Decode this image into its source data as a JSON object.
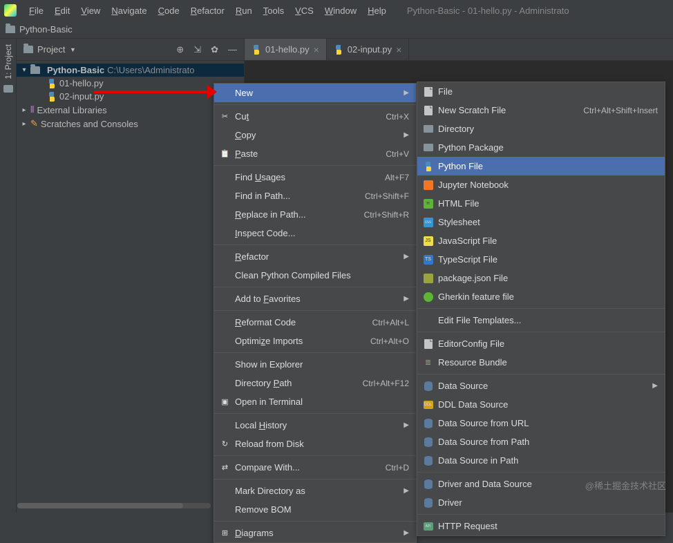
{
  "window_title": "Python-Basic - 01-hello.py - Administrato",
  "menus": [
    "File",
    "Edit",
    "View",
    "Navigate",
    "Code",
    "Refactor",
    "Run",
    "Tools",
    "VCS",
    "Window",
    "Help"
  ],
  "breadcrumb_root": "Python-Basic",
  "sidebar_tab": "1: Project",
  "project_selector": "Project",
  "header_icons": [
    "target",
    "autoscroll",
    "settings",
    "minimize"
  ],
  "tree": {
    "root": {
      "name": "Python-Basic",
      "path": "C:\\Users\\Administrato"
    },
    "files": [
      "01-hello.py",
      "02-input.py"
    ],
    "items": [
      "External Libraries",
      "Scratches and Consoles"
    ]
  },
  "tabs": [
    {
      "name": "01-hello.py",
      "active": true
    },
    {
      "name": "02-input.py",
      "active": false
    }
  ],
  "context_menu_1": [
    {
      "t": "hl",
      "label": "New",
      "submenu": true
    },
    {
      "t": "sep"
    },
    {
      "t": "item",
      "label": "Cut",
      "sc": "Ctrl+X",
      "ul": "t",
      "ico": "scissors"
    },
    {
      "t": "item",
      "label": "Copy",
      "sc": "",
      "ul": "C",
      "submenu": true
    },
    {
      "t": "item",
      "label": "Paste",
      "sc": "Ctrl+V",
      "ul": "P",
      "ico": "paste"
    },
    {
      "t": "sep"
    },
    {
      "t": "item",
      "label": "Find Usages",
      "sc": "Alt+F7",
      "ul": "U"
    },
    {
      "t": "item",
      "label": "Find in Path...",
      "sc": "Ctrl+Shift+F"
    },
    {
      "t": "item",
      "label": "Replace in Path...",
      "sc": "Ctrl+Shift+R",
      "ul": "R"
    },
    {
      "t": "item",
      "label": "Inspect Code...",
      "ul": "I"
    },
    {
      "t": "sep"
    },
    {
      "t": "item",
      "label": "Refactor",
      "ul": "R",
      "submenu": true
    },
    {
      "t": "item",
      "label": "Clean Python Compiled Files"
    },
    {
      "t": "sep"
    },
    {
      "t": "item",
      "label": "Add to Favorites",
      "ul": "F",
      "submenu": true
    },
    {
      "t": "sep"
    },
    {
      "t": "item",
      "label": "Reformat Code",
      "sc": "Ctrl+Alt+L",
      "ul": "R"
    },
    {
      "t": "item",
      "label": "Optimize Imports",
      "sc": "Ctrl+Alt+O",
      "ul": "z"
    },
    {
      "t": "sep"
    },
    {
      "t": "item",
      "label": "Show in Explorer"
    },
    {
      "t": "item",
      "label": "Directory Path",
      "sc": "Ctrl+Alt+F12",
      "ul": "P"
    },
    {
      "t": "item",
      "label": "Open in Terminal",
      "ico": "terminal"
    },
    {
      "t": "sep"
    },
    {
      "t": "item",
      "label": "Local History",
      "ul": "H",
      "submenu": true
    },
    {
      "t": "item",
      "label": "Reload from Disk",
      "ico": "reload"
    },
    {
      "t": "sep"
    },
    {
      "t": "item",
      "label": "Compare With...",
      "sc": "Ctrl+D",
      "ico": "compare"
    },
    {
      "t": "sep"
    },
    {
      "t": "item",
      "label": "Mark Directory as",
      "submenu": true
    },
    {
      "t": "item",
      "label": "Remove BOM"
    },
    {
      "t": "sep"
    },
    {
      "t": "item",
      "label": "Diagrams",
      "ul": "D",
      "submenu": true,
      "ico": "diagram"
    }
  ],
  "context_menu_2": [
    {
      "t": "item",
      "label": "File",
      "ico": "file"
    },
    {
      "t": "item",
      "label": "New Scratch File",
      "sc": "Ctrl+Alt+Shift+Insert",
      "ico": "file"
    },
    {
      "t": "item",
      "label": "Directory",
      "ico": "dir"
    },
    {
      "t": "item",
      "label": "Python Package",
      "ico": "dir"
    },
    {
      "t": "hl",
      "label": "Python File",
      "ico": "py"
    },
    {
      "t": "item",
      "label": "Jupyter Notebook",
      "ico": "ipynb"
    },
    {
      "t": "item",
      "label": "HTML File",
      "ico": "html"
    },
    {
      "t": "item",
      "label": "Stylesheet",
      "ico": "css"
    },
    {
      "t": "item",
      "label": "JavaScript File",
      "ico": "js"
    },
    {
      "t": "item",
      "label": "TypeScript File",
      "ico": "ts"
    },
    {
      "t": "item",
      "label": "package.json File",
      "ico": "json"
    },
    {
      "t": "item",
      "label": "Gherkin feature file",
      "ico": "gherkin"
    },
    {
      "t": "sep"
    },
    {
      "t": "item",
      "label": "Edit File Templates..."
    },
    {
      "t": "sep"
    },
    {
      "t": "item",
      "label": "EditorConfig File",
      "ico": "file"
    },
    {
      "t": "item",
      "label": "Resource Bundle",
      "ico": "bundle"
    },
    {
      "t": "sep"
    },
    {
      "t": "item",
      "label": "Data Source",
      "submenu": true,
      "ico": "db"
    },
    {
      "t": "item",
      "label": "DDL Data Source",
      "ico": "ddl"
    },
    {
      "t": "item",
      "label": "Data Source from URL",
      "ico": "db"
    },
    {
      "t": "item",
      "label": "Data Source from Path",
      "ico": "db"
    },
    {
      "t": "item",
      "label": "Data Source in Path",
      "ico": "db"
    },
    {
      "t": "sep"
    },
    {
      "t": "item",
      "label": "Driver and Data Source",
      "ico": "db"
    },
    {
      "t": "item",
      "label": "Driver",
      "ico": "db"
    },
    {
      "t": "sep"
    },
    {
      "t": "item",
      "label": "HTTP Request",
      "ico": "http"
    }
  ],
  "watermark": "@稀土掘金技术社区"
}
